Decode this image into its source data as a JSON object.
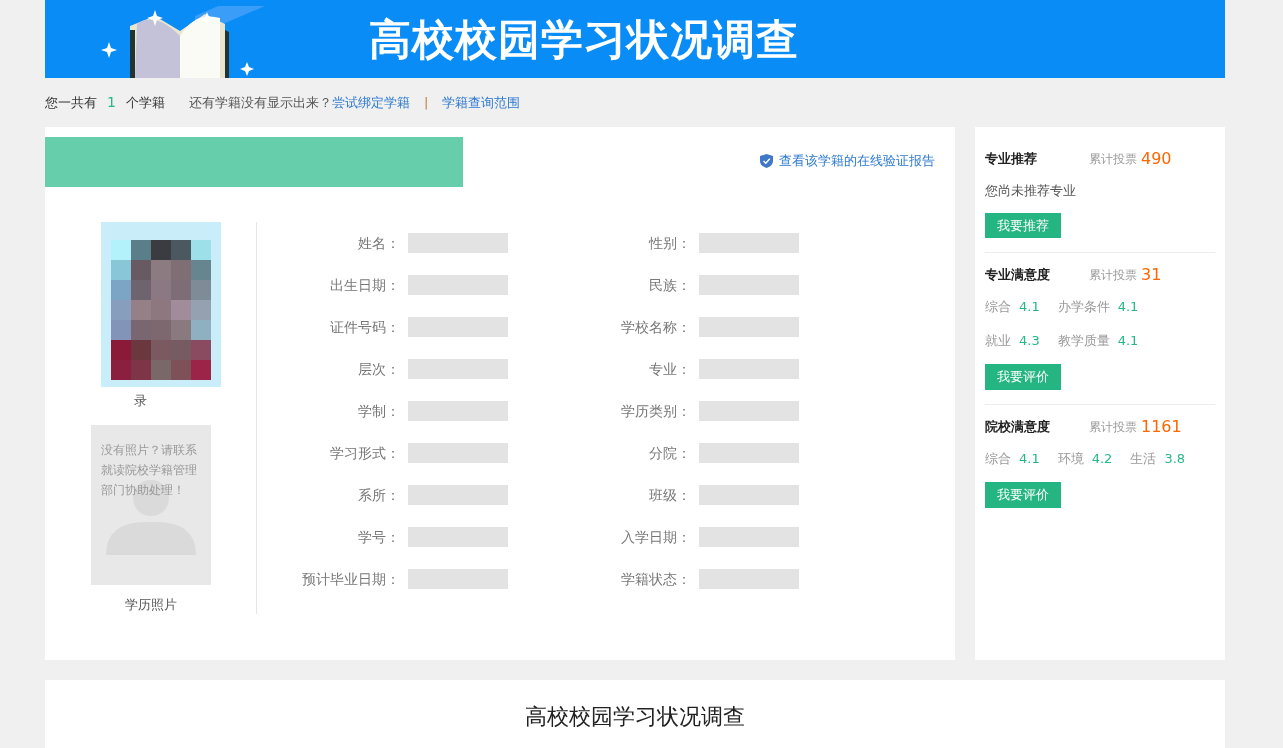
{
  "banner": {
    "title": "高校校园学习状况调查"
  },
  "summary": {
    "prefix": "您一共有",
    "count": "1",
    "suffix": "个学籍",
    "question": "还有学籍没有显示出来？",
    "bind_link": "尝试绑定学籍",
    "separator": "|",
    "range_link": "学籍查询范围"
  },
  "record": {
    "report_link": "查看该学籍的在线验证报告",
    "admission_photo_label": "录",
    "no_photo_text": "没有照片？请联系就读院校学籍管理部门协助处理！",
    "education_photo_label": "学历照片",
    "fields_left": [
      {
        "label": "姓名："
      },
      {
        "label": "出生日期："
      },
      {
        "label": "证件号码："
      },
      {
        "label": "层次："
      },
      {
        "label": "学制："
      },
      {
        "label": "学习形式："
      },
      {
        "label": "系所："
      },
      {
        "label": "学号："
      },
      {
        "label": "预计毕业日期："
      }
    ],
    "fields_right": [
      {
        "label": "性别："
      },
      {
        "label": "民族："
      },
      {
        "label": "学校名称："
      },
      {
        "label": "专业："
      },
      {
        "label": "学历类别："
      },
      {
        "label": "分院："
      },
      {
        "label": "班级："
      },
      {
        "label": "入学日期："
      },
      {
        "label": "学籍状态："
      }
    ]
  },
  "sidebar": [
    {
      "title": "专业推荐",
      "votes_label": "累计投票",
      "votes": "490",
      "note": "您尚未推荐专业",
      "button": "我要推荐"
    },
    {
      "title": "专业满意度",
      "votes_label": "累计投票",
      "votes": "31",
      "scores": [
        [
          {
            "label": "综合",
            "value": "4.1"
          },
          {
            "label": "办学条件",
            "value": "4.1"
          }
        ],
        [
          {
            "label": "就业",
            "value": "4.3"
          },
          {
            "label": "教学质量",
            "value": "4.1"
          }
        ]
      ],
      "button": "我要评价"
    },
    {
      "title": "院校满意度",
      "votes_label": "累计投票",
      "votes": "1161",
      "scores": [
        [
          {
            "label": "综合",
            "value": "4.1"
          },
          {
            "label": "环境",
            "value": "4.2"
          },
          {
            "label": "生活",
            "value": "3.8"
          }
        ]
      ],
      "button": "我要评价"
    }
  ],
  "survey": {
    "title": "高校校园学习状况调查"
  }
}
